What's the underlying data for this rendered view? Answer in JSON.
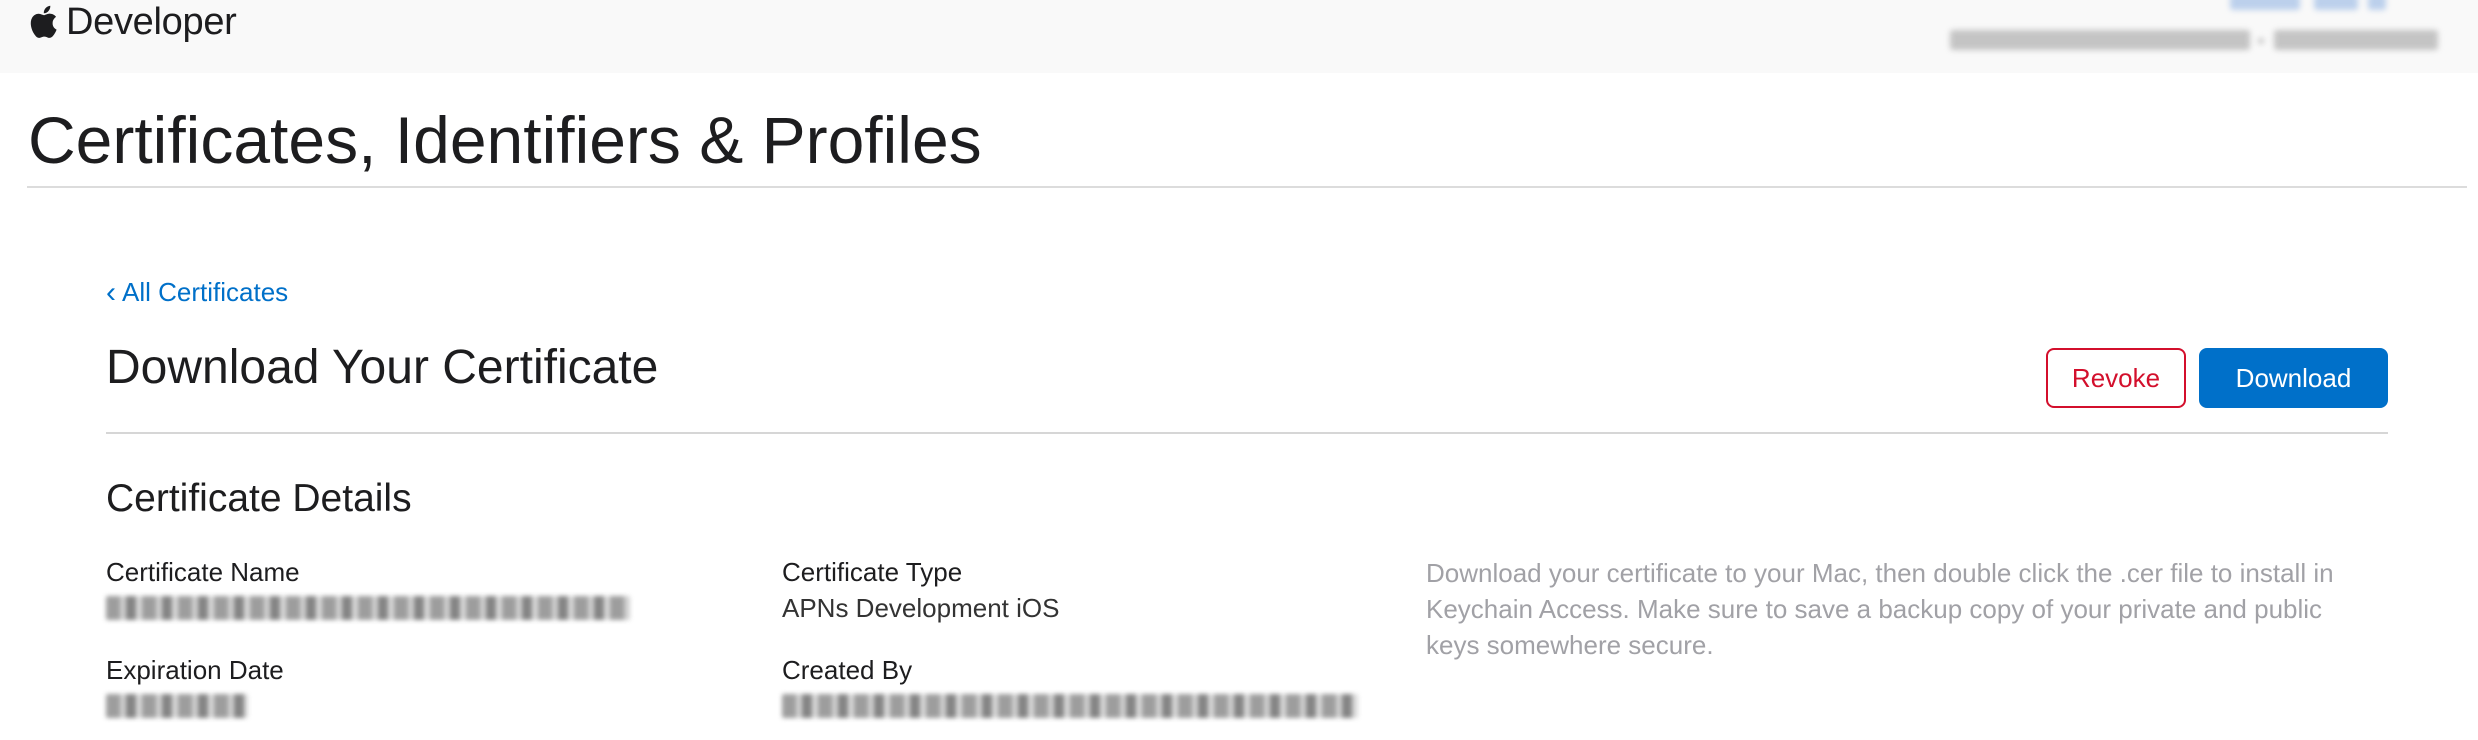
{
  "header": {
    "brand_label": "Developer",
    "logo_icon": "apple-logo-icon"
  },
  "page": {
    "title": "Certificates, Identifiers & Profiles"
  },
  "nav": {
    "back_link_label": "All Certificates",
    "back_icon": "chevron-left-icon"
  },
  "certificate": {
    "heading": "Download Your Certificate",
    "revoke_label": "Revoke",
    "download_label": "Download",
    "details_heading": "Certificate Details",
    "fields": {
      "name_label": "Certificate Name",
      "type_label": "Certificate Type",
      "type_value": "APNs Development iOS",
      "expiration_label": "Expiration Date",
      "created_by_label": "Created By"
    },
    "help_text": "Download your certificate to your Mac, then double click the .cer file to install in Keychain Access. Make sure to save a backup copy of your private and public keys somewhere secure."
  },
  "colors": {
    "accent_blue": "#0070c9",
    "revoke_red": "#d30f2c",
    "nav_bg": "#f9f9f9",
    "muted_text": "#a1a1a6"
  }
}
